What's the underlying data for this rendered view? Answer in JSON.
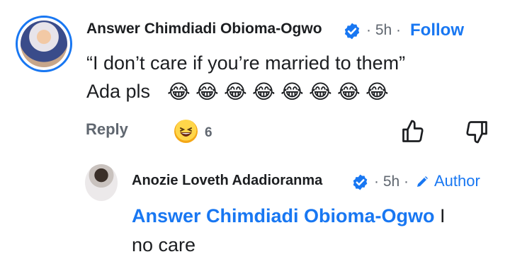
{
  "comment": {
    "author": "Answer Chimdiadi Obioma-Ogwo",
    "time": "· 5h ·",
    "follow_label": "Follow",
    "line1": "“I don’t care if you’re married to them”",
    "line2_text": "Ada pls",
    "line2_emojis": [
      "😂",
      "😂",
      "😂",
      "😂",
      "😂",
      "😂",
      "😂",
      "😂"
    ],
    "reply_label": "Reply",
    "reaction_count": "6",
    "reaction_icon": "grinning-squinting-face-icon",
    "like_icon": "thumbs-up-icon",
    "dislike_icon": "thumbs-down-icon"
  },
  "reply": {
    "author": "Anozie Loveth Adadioranma",
    "time": "· 5h ·",
    "author_badge": "Author",
    "mention": "Answer Chimdiadi Obioma-Ogwo",
    "mention_suffix": " I",
    "line2": "no care"
  },
  "colors": {
    "accent": "#1877f2",
    "muted": "#606770",
    "text": "#1c1e21"
  }
}
